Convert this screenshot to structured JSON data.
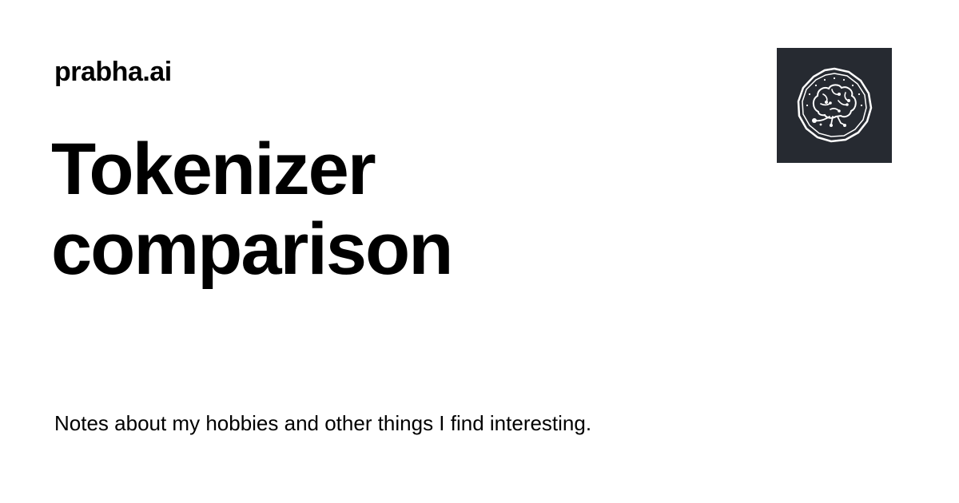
{
  "header": {
    "site_name": "prabha.ai"
  },
  "main": {
    "title_line_1": "Tokenizer",
    "title_line_2": "comparison",
    "description": "Notes about my hobbies and other things I find interesting."
  },
  "logo": {
    "icon": "brain-circuit-icon",
    "background_color": "#262a31",
    "foreground_color": "#ffffff"
  }
}
